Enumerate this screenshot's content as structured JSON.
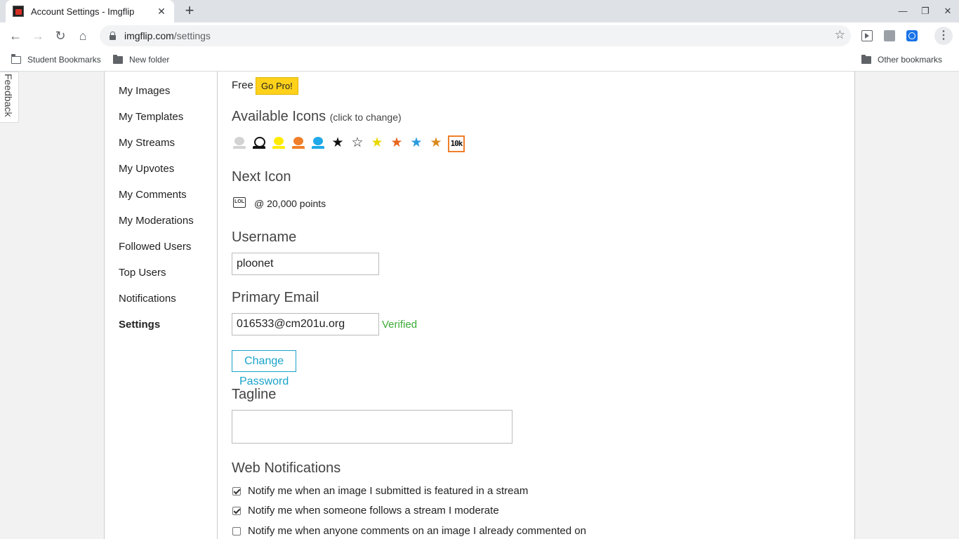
{
  "browser": {
    "tab_title": "Account Settings - Imgflip",
    "url_domain": "imgflip.com",
    "url_path": "/settings",
    "bookmarks": [
      "Student Bookmarks",
      "New folder"
    ],
    "other_bookmarks": "Other bookmarks"
  },
  "feedback": "Feedback",
  "sidebar": {
    "items": [
      {
        "label": "My Images"
      },
      {
        "label": "My Templates"
      },
      {
        "label": "My Streams"
      },
      {
        "label": "My Upvotes"
      },
      {
        "label": "My Comments"
      },
      {
        "label": "My Moderations"
      },
      {
        "label": "Followed Users"
      },
      {
        "label": "Top Users"
      },
      {
        "label": "Notifications"
      },
      {
        "label": "Settings",
        "active": true
      }
    ]
  },
  "account": {
    "plan": "Free",
    "go_pro": "Go Pro!"
  },
  "icons": {
    "heading": "Available Icons",
    "hint": "(click to change)",
    "items": [
      "user-gray-icon",
      "user-black-outline-icon",
      "user-yellow-icon",
      "user-orange-icon",
      "user-blue-icon",
      "star-black-icon",
      "star-outline-icon",
      "star-yellow-icon",
      "star-orange-icon",
      "star-blue-icon",
      "star-gold-icon",
      "10k-icon"
    ],
    "tenk_label": "10k"
  },
  "next_icon": {
    "heading": "Next Icon",
    "icon_label": "LOL",
    "points": "@ 20,000 points"
  },
  "username": {
    "label": "Username",
    "value": "ploonet"
  },
  "email": {
    "label": "Primary Email",
    "value": "016533@cm201u.org",
    "status": "Verified"
  },
  "change_password": "Change Password",
  "tagline": {
    "label": "Tagline",
    "value": ""
  },
  "web_notifications": {
    "heading": "Web Notifications",
    "options": [
      {
        "label": "Notify me when an image I submitted is featured in a stream",
        "checked": true
      },
      {
        "label": "Notify me when someone follows a stream I moderate",
        "checked": true
      },
      {
        "label": "Notify me when anyone comments on an image I already commented on",
        "checked": false
      }
    ]
  },
  "colors": {
    "accent": "#1aa3c9",
    "verified": "#3aaa35",
    "go_pro": "#ffd11a"
  }
}
